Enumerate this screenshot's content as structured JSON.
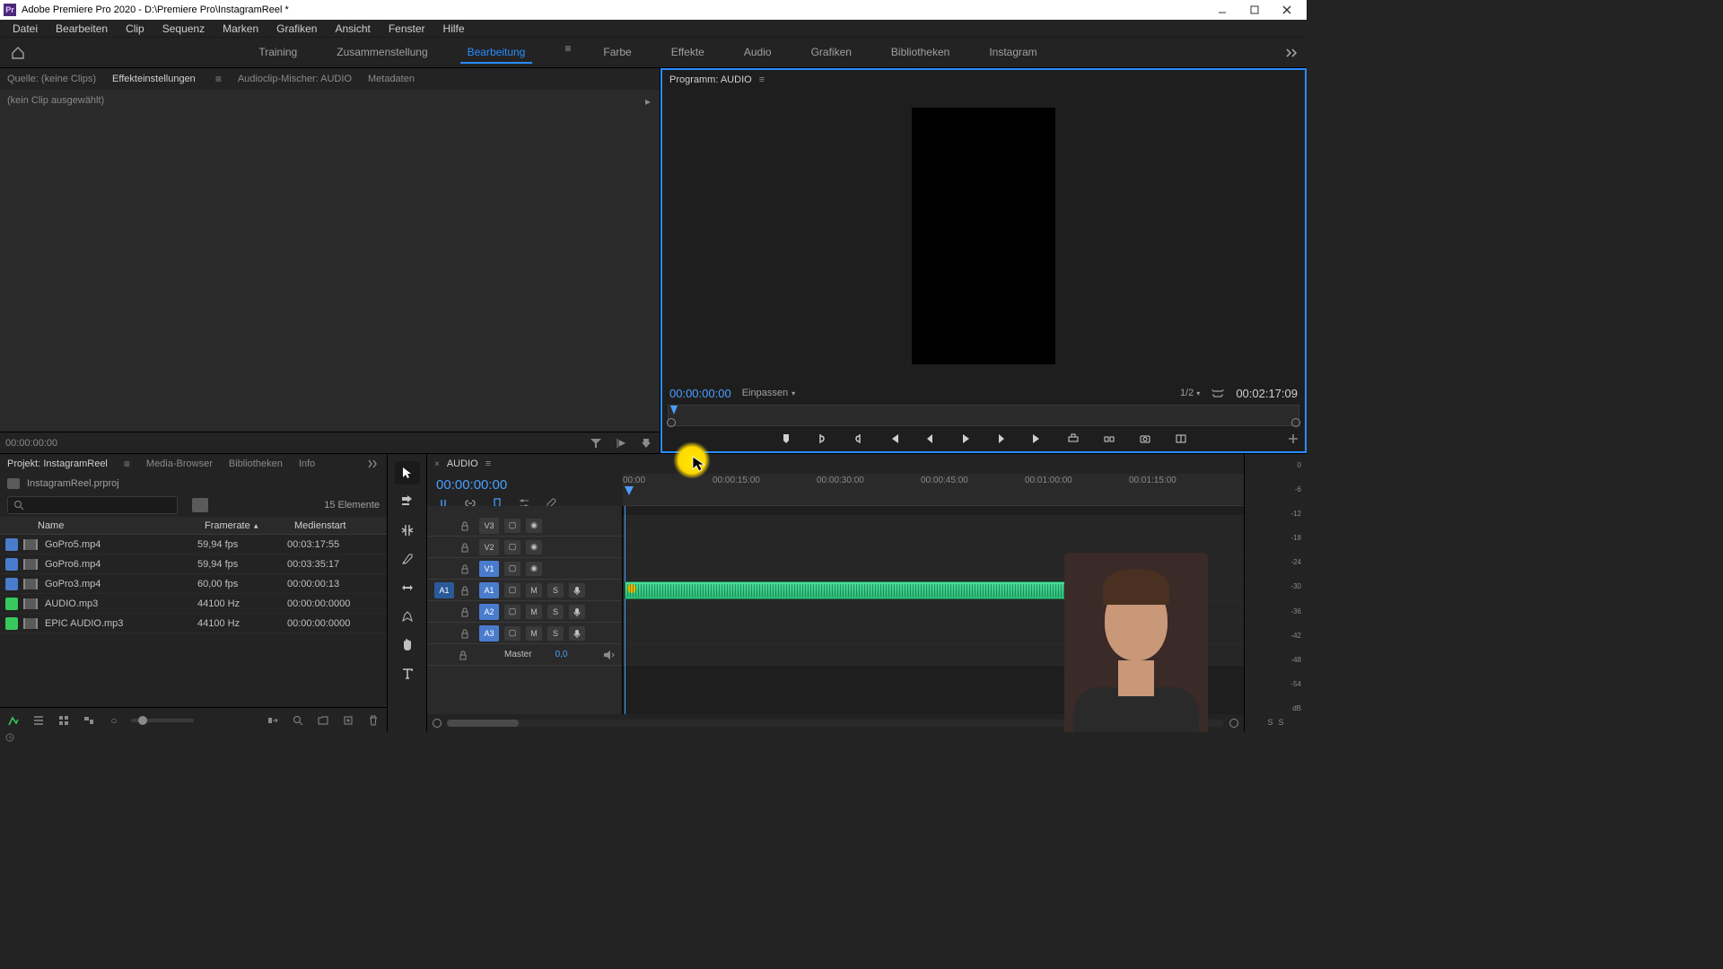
{
  "titlebar": {
    "app": "Adobe Premiere Pro 2020",
    "path": "D:\\Premiere Pro\\InstagramReel *"
  },
  "menu": [
    "Datei",
    "Bearbeiten",
    "Clip",
    "Sequenz",
    "Marken",
    "Grafiken",
    "Ansicht",
    "Fenster",
    "Hilfe"
  ],
  "workspaces": {
    "items": [
      "Training",
      "Zusammenstellung",
      "Bearbeitung",
      "Farbe",
      "Effekte",
      "Audio",
      "Grafiken",
      "Bibliotheken",
      "Instagram"
    ],
    "active": "Bearbeitung"
  },
  "source_tabs": {
    "items": [
      "Quelle: (keine Clips)",
      "Effekteinstellungen",
      "Audioclip-Mischer: AUDIO",
      "Metadaten"
    ],
    "active": 1,
    "no_clip": "(kein Clip ausgewählt)",
    "time": "00:00:00:00"
  },
  "program": {
    "title": "Programm: AUDIO",
    "tc": "00:00:00:00",
    "fit": "Einpassen",
    "zoom": "1/2",
    "duration": "00:02:17:09"
  },
  "project": {
    "tabs": [
      "Projekt: InstagramReel",
      "Media-Browser",
      "Bibliotheken",
      "Info"
    ],
    "file": "InstagramReel.prproj",
    "count": "15 Elemente",
    "columns": {
      "name": "Name",
      "framerate": "Framerate",
      "mediastart": "Medienstart"
    },
    "rows": [
      {
        "swatch": "blue",
        "name": "GoPro5.mp4",
        "fr": "59,94 fps",
        "ms": "00:03:17:55"
      },
      {
        "swatch": "blue",
        "name": "GoPro6.mp4",
        "fr": "59,94 fps",
        "ms": "00:03:35:17"
      },
      {
        "swatch": "blue",
        "name": "GoPro3.mp4",
        "fr": "60,00 fps",
        "ms": "00:00:00:13"
      },
      {
        "swatch": "green",
        "name": "AUDIO.mp3",
        "fr": "44100 Hz",
        "ms": "00:00:00:0000"
      },
      {
        "swatch": "green",
        "name": "EPIC AUDIO.mp3",
        "fr": "44100 Hz",
        "ms": "00:00:00:0000"
      }
    ]
  },
  "timeline": {
    "seq_name": "AUDIO",
    "tc": "00:00:00:00",
    "ruler": [
      "00:00",
      "00:00:15:00",
      "00:00:30:00",
      "00:00:45:00",
      "00:01:00:00",
      "00:01:15:00"
    ],
    "tracks": {
      "v": [
        "V3",
        "V2",
        "V1"
      ],
      "a": [
        "A1",
        "A2",
        "A3"
      ],
      "master": "Master",
      "master_val": "0,0"
    }
  },
  "meters": {
    "ticks": [
      "0",
      "-6",
      "-12",
      "-18",
      "-24",
      "-30",
      "-36",
      "-42",
      "-48",
      "-54",
      "dB"
    ],
    "s": "S"
  }
}
